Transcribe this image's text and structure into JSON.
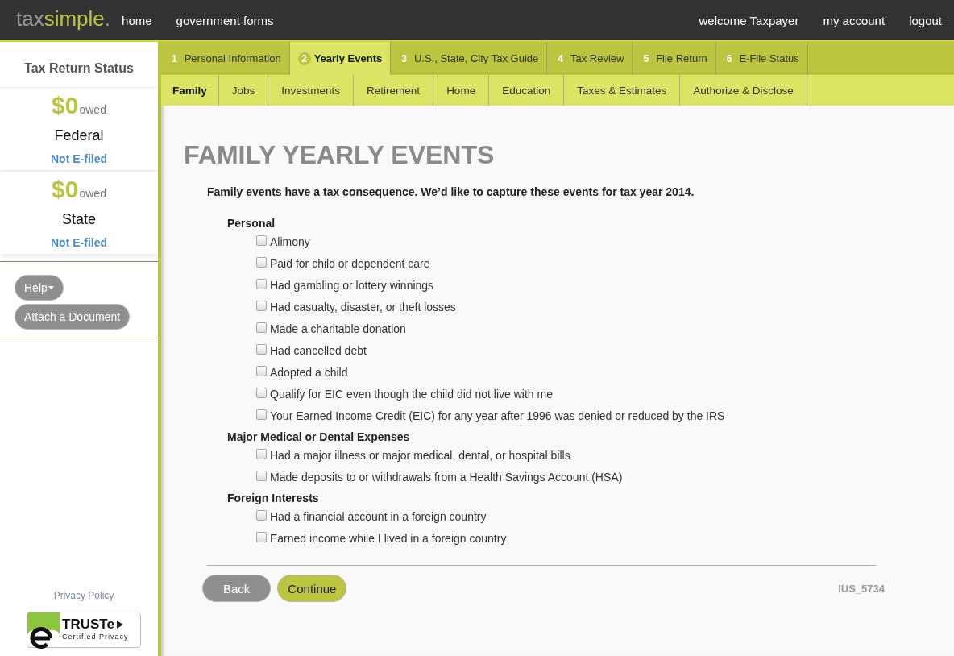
{
  "header": {
    "logo": [
      {
        "kind": "muted",
        "text": "tax"
      },
      {
        "kind": "accent",
        "text": "simple"
      },
      {
        "kind": "muted",
        "text": "."
      }
    ],
    "nav_links": [
      "home",
      "government forms"
    ],
    "greeting": "welcome Taxpayer",
    "account_links": [
      "my account",
      "logout"
    ]
  },
  "steps": [
    {
      "number": "1",
      "label": "Personal Information",
      "selected": false
    },
    {
      "number": "2",
      "label": "Yearly Events",
      "selected": true
    },
    {
      "number": "3",
      "label": "U.S., State, City Tax Guide",
      "selected": false
    },
    {
      "number": "4",
      "label": "Tax Review",
      "selected": false
    },
    {
      "number": "5",
      "label": "File Return",
      "selected": false
    },
    {
      "number": "6",
      "label": "E-File Status",
      "selected": false
    }
  ],
  "subtabs": [
    {
      "label": "Family",
      "selected": true
    },
    {
      "label": "Jobs",
      "selected": false
    },
    {
      "label": "Investments",
      "selected": false
    },
    {
      "label": "Retirement",
      "selected": false
    },
    {
      "label": "Home",
      "selected": false
    },
    {
      "label": "Education",
      "selected": false
    },
    {
      "label": "Taxes & Estimates",
      "selected": false
    },
    {
      "label": "Authorize & Disclose",
      "selected": false
    }
  ],
  "sidebar": {
    "title": "Tax Return Status",
    "returns": [
      {
        "amount": "$0",
        "unit": "owed",
        "name": "Federal",
        "status": "Not E-filed"
      },
      {
        "amount": "$0",
        "unit": "owed",
        "name": "State",
        "status": "Not E-filed"
      }
    ],
    "buttons": [
      {
        "label": "Help",
        "kind": "dropdown"
      },
      {
        "label": "Attach a Document",
        "kind": "plain"
      }
    ],
    "privacy_link": "Privacy Policy",
    "seal": {
      "title": "TRUSTe",
      "subtitle": "Certified Privacy"
    }
  },
  "page": {
    "title": "FAMILY YEARLY EVENTS",
    "intro": "Family events have a tax consequence. We’d like to capture these events for tax year 2014.",
    "groups": [
      {
        "heading": "Personal",
        "items": [
          {
            "label": "Alimony",
            "checked": false
          },
          {
            "label": "Paid for child or dependent care",
            "checked": false
          },
          {
            "label": "Had gambling or lottery winnings",
            "checked": false
          },
          {
            "label": "Had casualty, disaster, or theft losses",
            "checked": false
          },
          {
            "label": "Made a charitable donation",
            "checked": false
          },
          {
            "label": "Had cancelled debt",
            "checked": false
          },
          {
            "label": "Adopted a child",
            "checked": false
          },
          {
            "label": "Qualify for EIC even though the child did not live with me",
            "checked": false
          },
          {
            "label": "Your Earned Income Credit (EIC) for any year after 1996 was denied or reduced by the IRS",
            "checked": false
          }
        ]
      },
      {
        "heading": "Major Medical or Dental Expenses",
        "items": [
          {
            "label": "Had a major illness or major medical, dental, or hospital bills",
            "checked": false
          },
          {
            "label": "Made deposits to or withdrawals from a Health Savings Account (HSA)",
            "checked": false
          }
        ]
      },
      {
        "heading": "Foreign Interests",
        "items": [
          {
            "label": "Had a financial account in a foreign country",
            "checked": false
          },
          {
            "label": "Earned income while I lived in a foreign country",
            "checked": false
          }
        ]
      }
    ]
  },
  "footer": {
    "buttons": [
      {
        "label": "Back",
        "kind": "secondary"
      },
      {
        "label": "Continue",
        "kind": "primary"
      }
    ],
    "page_code": "IUS_5734"
  }
}
